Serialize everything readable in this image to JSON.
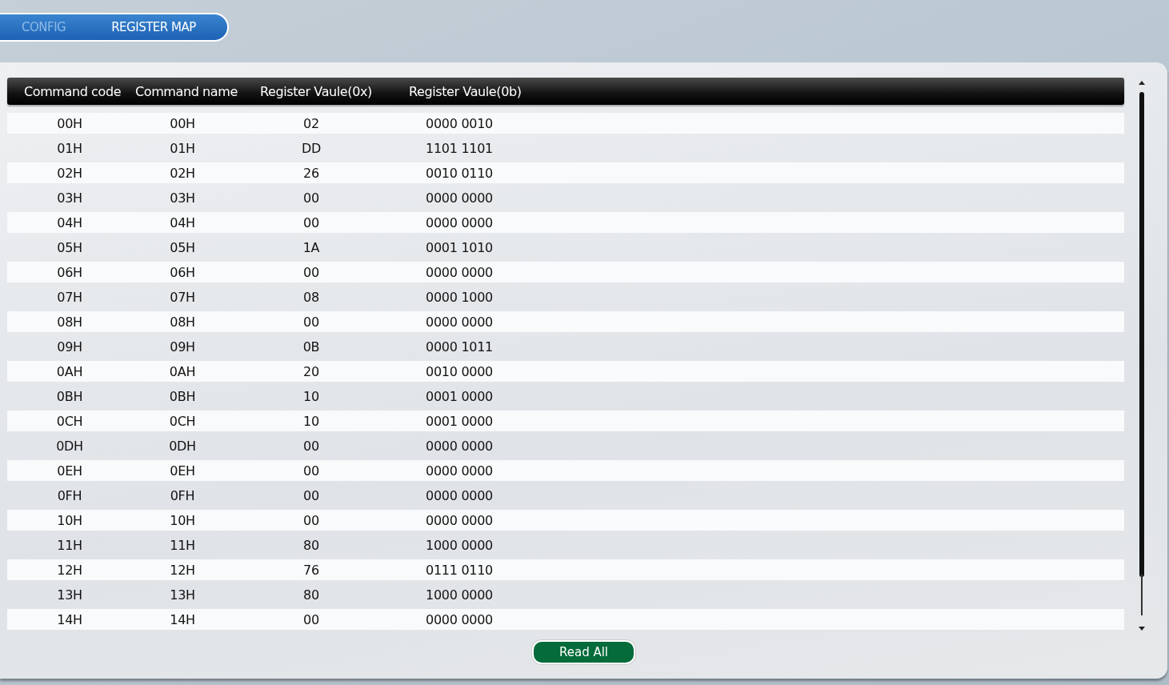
{
  "tabs": [
    {
      "label": "CONFIG",
      "selected": false
    },
    {
      "label": "REGISTER MAP",
      "selected": true
    }
  ],
  "table": {
    "columns": [
      "Command code",
      "Command name",
      "Register Vaule(0x)",
      "Register Vaule(0b)"
    ],
    "rows": [
      [
        "00H",
        "00H",
        "02",
        "0000 0010"
      ],
      [
        "01H",
        "01H",
        "DD",
        "1101 1101"
      ],
      [
        "02H",
        "02H",
        "26",
        "0010 0110"
      ],
      [
        "03H",
        "03H",
        "00",
        "0000 0000"
      ],
      [
        "04H",
        "04H",
        "00",
        "0000 0000"
      ],
      [
        "05H",
        "05H",
        "1A",
        "0001 1010"
      ],
      [
        "06H",
        "06H",
        "00",
        "0000 0000"
      ],
      [
        "07H",
        "07H",
        "08",
        "0000 1000"
      ],
      [
        "08H",
        "08H",
        "00",
        "0000 0000"
      ],
      [
        "09H",
        "09H",
        "0B",
        "0000 1011"
      ],
      [
        "0AH",
        "0AH",
        "20",
        "0010 0000"
      ],
      [
        "0BH",
        "0BH",
        "10",
        "0001 0000"
      ],
      [
        "0CH",
        "0CH",
        "10",
        "0001 0000"
      ],
      [
        "0DH",
        "0DH",
        "00",
        "0000 0000"
      ],
      [
        "0EH",
        "0EH",
        "00",
        "0000 0000"
      ],
      [
        "0FH",
        "0FH",
        "00",
        "0000 0000"
      ],
      [
        "10H",
        "10H",
        "00",
        "0000 0000"
      ],
      [
        "11H",
        "11H",
        "80",
        "1000 0000"
      ],
      [
        "12H",
        "12H",
        "76",
        "0111 0110"
      ],
      [
        "13H",
        "13H",
        "80",
        "1000 0000"
      ],
      [
        "14H",
        "14H",
        "00",
        "0000 0000"
      ]
    ]
  },
  "buttons": [
    "Read All"
  ]
}
